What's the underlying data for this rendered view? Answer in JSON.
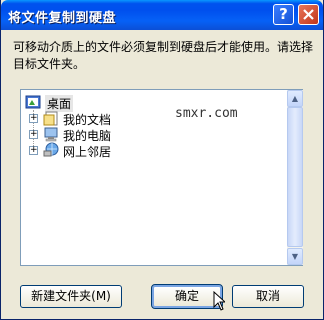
{
  "window": {
    "title": "将文件复制到硬盘",
    "help_symbol": "?",
    "close_symbol": "✕"
  },
  "description": "可移动介质上的文件必须复制到硬盘后才能使用。请选择目标文件夹。",
  "tree": {
    "root": {
      "label": "桌面",
      "icon": "desktop-icon"
    },
    "items": [
      {
        "label": "我的文档",
        "expander": "+",
        "icon": "my-documents-icon"
      },
      {
        "label": "我的电脑",
        "expander": "+",
        "icon": "my-computer-icon"
      },
      {
        "label": "网上邻居",
        "expander": "+",
        "icon": "network-places-icon"
      }
    ]
  },
  "watermark": "smxr.com",
  "buttons": {
    "new_folder": "新建文件夹(M)",
    "ok": "确定",
    "cancel": "取消"
  },
  "scroll": {
    "up": "▲",
    "down": "▼"
  },
  "colors": {
    "titlebar": "#0053ee",
    "dialog_bg": "#ece9d8"
  }
}
